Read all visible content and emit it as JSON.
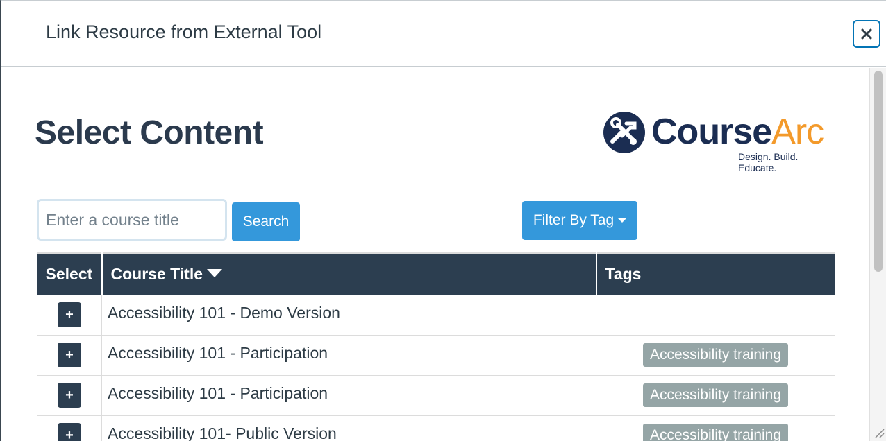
{
  "dialog": {
    "title": "Link Resource from External Tool",
    "close_label": "×"
  },
  "page": {
    "heading": "Select Content"
  },
  "logo": {
    "word_1": "Course",
    "word_2": "Arc",
    "tagline": "Design. Build. Educate.",
    "icon": "wrench-hammer-icon",
    "brand_color": "#1b2d52",
    "accent_color": "#f39a2b"
  },
  "search": {
    "placeholder": "Enter a course title",
    "value": "",
    "button_label": "Search"
  },
  "filter": {
    "button_label": "Filter By Tag"
  },
  "table": {
    "headers": {
      "select": "Select",
      "title": "Course Title",
      "tags": "Tags"
    },
    "rows": [
      {
        "add": "+",
        "title": "Accessibility 101 - Demo Version",
        "tag": ""
      },
      {
        "add": "+",
        "title": "Accessibility 101 - Participation",
        "tag": "Accessibility training"
      },
      {
        "add": "+",
        "title": "Accessibility 101 - Participation",
        "tag": "Accessibility training"
      },
      {
        "add": "+",
        "title": "Accessibility 101- Public Version",
        "tag": "Accessibility training"
      }
    ]
  },
  "colors": {
    "header_bg": "#2c3e50",
    "button_blue": "#3498db",
    "tag_bg": "#95a5a6",
    "focus_ring": "#0374b5"
  }
}
